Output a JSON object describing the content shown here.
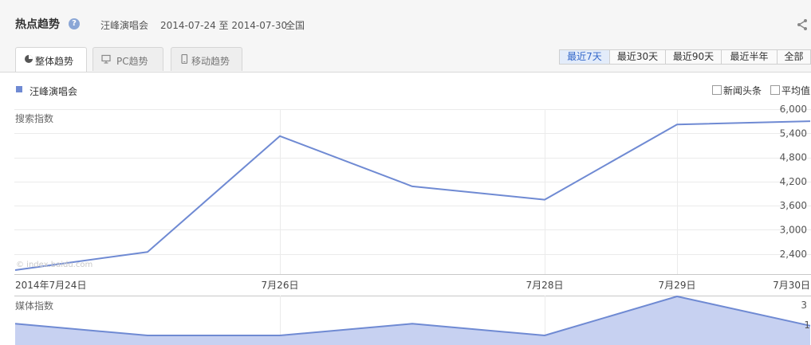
{
  "header": {
    "title": "热点趋势",
    "help_glyph": "?",
    "keyword": "汪峰演唱会",
    "date_range": "2014-07-24 至 2014-07-30",
    "region": "全国"
  },
  "tabs": [
    {
      "label": "整体趋势",
      "icon": "pie-icon"
    },
    {
      "label": "PC趋势",
      "icon": "monitor-icon"
    },
    {
      "label": "移动趋势",
      "icon": "mobile-icon"
    }
  ],
  "range_buttons": [
    "最近7天",
    "最近30天",
    "最近90天",
    "最近半年",
    "全部"
  ],
  "range_active": "最近7天",
  "legend": {
    "label": "汪峰演唱会",
    "color": "#6f8ad3"
  },
  "options": {
    "news_label": "新闻头条",
    "average_label": "平均值"
  },
  "watermark": "© index.baidu.com",
  "colors": {
    "line": "#6f8ad3",
    "area": "#c7d1f1",
    "grid": "#ebebeb",
    "axis": "#c8c8c8"
  },
  "chart_data": [
    {
      "type": "line",
      "ylabel": "搜索指数",
      "x": [
        "2014-07-24",
        "2014-07-25",
        "2014-07-26",
        "2014-07-27",
        "2014-07-28",
        "2014-07-29",
        "2014-07-30"
      ],
      "x_tick_labels": [
        "2014年7月24日",
        "",
        "7月26日",
        "",
        "7月28日",
        "7月29日",
        "7月30日"
      ],
      "series": [
        {
          "name": "汪峰演唱会",
          "values": [
            2000,
            2450,
            5330,
            4080,
            3750,
            5620,
            5700
          ]
        }
      ],
      "y_ticks": [
        "6,000",
        "5,400",
        "4,800",
        "4,200",
        "3,600",
        "3,000",
        "2,400"
      ],
      "ylim": [
        1900,
        6000
      ],
      "grid": true
    },
    {
      "type": "area",
      "ylabel": "媒体指数",
      "x": [
        "2014-07-24",
        "2014-07-25",
        "2014-07-26",
        "2014-07-27",
        "2014-07-28",
        "2014-07-29",
        "2014-07-30"
      ],
      "series": [
        {
          "name": "汪峰演唱会",
          "values": [
            1.6,
            1.0,
            1.0,
            1.6,
            1.0,
            3.0,
            1.5
          ]
        }
      ],
      "y_ticks": [
        "3",
        "1"
      ],
      "ylim": [
        1,
        3
      ]
    }
  ]
}
